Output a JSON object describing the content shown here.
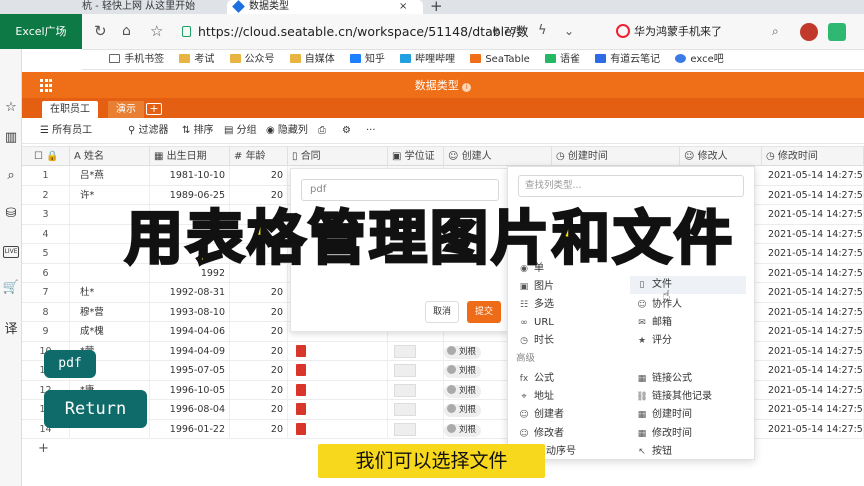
{
  "browser": {
    "tabs": [
      {
        "label": "杭 - 轻快上网 从这里开始"
      },
      {
        "label": "数据类型"
      }
    ],
    "new_tab": "+",
    "close_tab": "×",
    "url": "https://cloud.seatable.cn/workspace/51148/dtable/数",
    "zoom": "75%",
    "news": "华为鸿蒙手机来了",
    "bookmarks": [
      "手机书签",
      "考试",
      "公众号",
      "自媒体",
      "知乎",
      "哔哩哔哩",
      "SeaTable",
      "语雀",
      "有道云笔记",
      "exce吧"
    ]
  },
  "excel_badge": "Excel广场",
  "left_icons": [
    "star-icon",
    "book-icon",
    "search-icon",
    "package-icon",
    "live-icon",
    "cart-icon",
    "translate-icon"
  ],
  "left_icon_glyphs": [
    "☆",
    "▥",
    "⌕",
    "⛁",
    "LIVE",
    "🛒",
    "译"
  ],
  "app": {
    "title": "数据类型",
    "tabs": [
      "在职员工",
      "演示"
    ],
    "add_tab": "+",
    "toolbar": [
      "所有员工",
      "过滤器",
      "排序",
      "分组",
      "隐藏列"
    ],
    "toolbar_more": "···",
    "columns": [
      "姓名",
      "出生日期",
      "年龄",
      "合同",
      "学位证",
      "创建人",
      "创建时间",
      "修改人",
      "修改时间"
    ],
    "rows": [
      {
        "n": "1",
        "name": "吕*燕",
        "date": "1981-10-10",
        "age": "20",
        "pdf": false,
        "user": "",
        "mod": "2021-05-14 14:27:52"
      },
      {
        "n": "2",
        "name": "许*",
        "date": "1989-06-25",
        "age": "20",
        "pdf": false,
        "user": "",
        "mod": "2021-05-14 14:27:52"
      },
      {
        "n": "3",
        "name": "",
        "date": "",
        "age": "",
        "pdf": false,
        "user": "",
        "mod": "2021-05-14 14:27:52"
      },
      {
        "n": "4",
        "name": "",
        "date": "",
        "age": "",
        "pdf": false,
        "user": "",
        "mod": "2021-05-14 14:27:52"
      },
      {
        "n": "5",
        "name": "",
        "date": "",
        "age": "",
        "pdf": false,
        "user": "",
        "mod": "2021-05-14 14:27:52"
      },
      {
        "n": "6",
        "name": "",
        "date": "1992",
        "age": "",
        "pdf": false,
        "user": "",
        "mod": "2021-05-14 14:27:52"
      },
      {
        "n": "7",
        "name": "杜*",
        "date": "1992-08-31",
        "age": "20",
        "pdf": false,
        "user": "",
        "mod": "2021-05-14 14:27:52"
      },
      {
        "n": "8",
        "name": "穆*营",
        "date": "1993-08-10",
        "age": "20",
        "pdf": false,
        "user": "",
        "mod": "2021-05-14 14:27:52"
      },
      {
        "n": "9",
        "name": "成*槐",
        "date": "1994-04-06",
        "age": "20",
        "pdf": false,
        "user": "",
        "mod": "2021-05-14 14:27:52"
      },
      {
        "n": "10",
        "name": "*营",
        "date": "1994-04-09",
        "age": "20",
        "pdf": true,
        "user": "刘根",
        "mod": "2021-05-14 14:27:52"
      },
      {
        "n": "11",
        "name": "*程",
        "date": "1995-07-05",
        "age": "20",
        "pdf": true,
        "user": "刘根",
        "mod": "2021-05-14 14:27:52"
      },
      {
        "n": "12",
        "name": "*康",
        "date": "1996-10-05",
        "age": "20",
        "pdf": true,
        "user": "刘根",
        "mod": "2021-05-14 14:27:52"
      },
      {
        "n": "13",
        "name": "",
        "date": "1996-08-04",
        "age": "20",
        "pdf": true,
        "user": "刘根",
        "mod": "2021-05-14 14:27:52"
      },
      {
        "n": "14",
        "name": "",
        "date": "1996-01-22",
        "age": "20",
        "pdf": true,
        "user": "刘根",
        "mod": "2021-05-14 14:27:52"
      }
    ],
    "add_row": "+"
  },
  "dialog": {
    "input_value": "pdf",
    "cancel": "取消",
    "submit": "提交"
  },
  "type_menu": {
    "search_placeholder": "查找列类型...",
    "basic_left": [
      "单",
      "图片",
      "多选",
      "URL",
      "时长"
    ],
    "basic_right": [
      "文件",
      "协作人",
      "邮箱",
      "评分"
    ],
    "section_advanced": "高级",
    "adv_left": [
      "公式",
      "地址",
      "创建者",
      "修改者",
      "动序号"
    ],
    "adv_right": [
      "链接公式",
      "链接其他记录",
      "创建时间",
      "修改时间",
      "按钮"
    ]
  },
  "overlay": {
    "headline": "用表格管理图片和文件",
    "pdf_pill": "pdf",
    "return_pill": "Return",
    "subtitle": "我们可以选择文件"
  },
  "colors": {
    "brand_orange": "#ef6f18",
    "headline_yellow": "#f6dd1a",
    "pill_teal": "#0f6a6a",
    "excel_green": "#0d7a46"
  }
}
